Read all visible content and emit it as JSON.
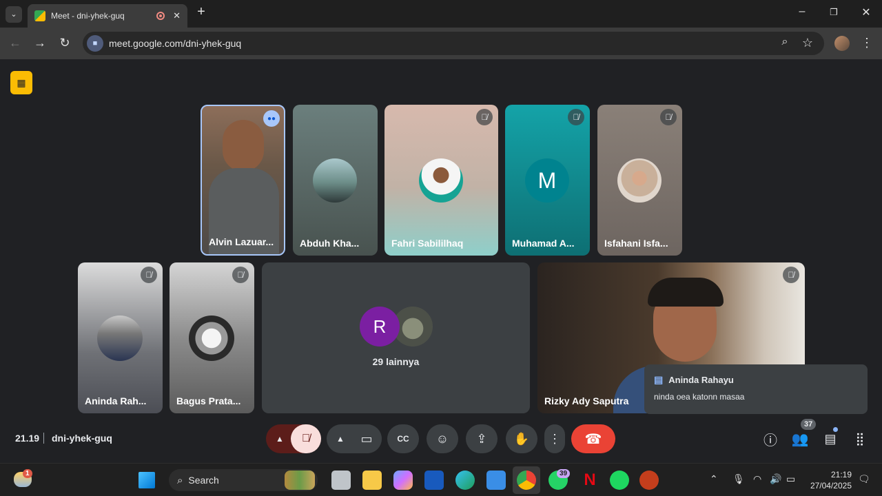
{
  "browser": {
    "tab_title": "Meet - dni-yhek-guq",
    "url": "meet.google.com/dni-yhek-guq",
    "new_tab": "+"
  },
  "participants": [
    {
      "name": "Alvin Lazuar...",
      "speaking": true
    },
    {
      "name": "Abduh Kha...",
      "muted": false
    },
    {
      "name": "Fahri Sabililhaq",
      "muted": true
    },
    {
      "name": "Muhamad A...",
      "initial": "M",
      "muted": true
    },
    {
      "name": "Isfahani Isfa...",
      "muted": true
    },
    {
      "name": "Aninda Rah...",
      "muted": true
    },
    {
      "name": "Bagus Prata...",
      "muted": true
    },
    {
      "name": "Rizky Ady Saputra",
      "muted": true
    }
  ],
  "others": {
    "initial": "R",
    "label": "29 lainnya"
  },
  "chat_toast": {
    "sender": "Aninda Rahayu",
    "message": "ninda oea katonn masaa"
  },
  "meeting": {
    "time": "21.19",
    "code": "dni-yhek-guq",
    "people_count": "37"
  },
  "taskbar": {
    "search_placeholder": "Search",
    "weather_badge": "1",
    "whatsapp_badge": "39",
    "clock_time": "21:19",
    "clock_date": "27/04/2025"
  },
  "colors": {
    "end_call": "#ea4335",
    "mic_muted": "#f9dedc",
    "accent": "#8ab4f8",
    "muhamad_avatar": "#00838f",
    "r_avatar": "#7b1fa2"
  }
}
